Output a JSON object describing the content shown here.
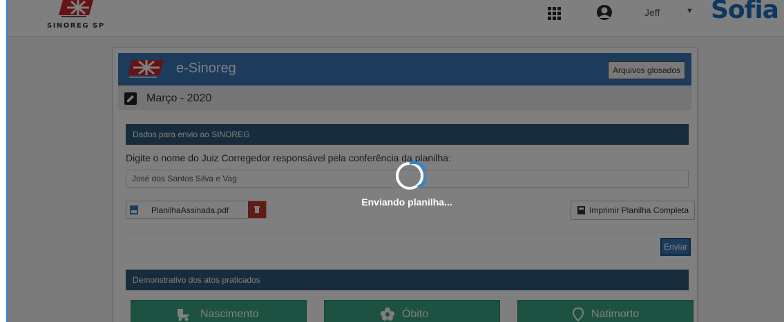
{
  "topbar": {
    "logo_text": "SINOREG SP",
    "user_name": "Jeff",
    "brand": "Sofia"
  },
  "card": {
    "header_title": "e-Sinoreg",
    "glosados_button": "Arquivos glosados",
    "period": "Março - 2020",
    "section_envio": "Dados para envio ao SINOREG",
    "prompt": "Digite o nome do Juiz Corregedor responsável pela conferência da planilha:",
    "judge_value": "José dos Santos Silva e Vag",
    "file_name": "PlanilhaAssinada.pdf",
    "print_button": "Imprimir Planilha Completa",
    "send_button": "Enviar",
    "section_atos": "Demonstrativo dos atos praticados",
    "acts": [
      "Nascimento",
      "Óbito",
      "Natimorto"
    ]
  },
  "overlay": {
    "loading_text": "Enviando planilha..."
  },
  "colors": {
    "header_blue": "#3b79b8",
    "section_navy": "#2f5878",
    "act_green": "#3aa382",
    "delete_red": "#c0392b",
    "brand_blue": "#1f6fbf"
  },
  "icons": [
    "apps-grid-icon",
    "user-avatar-icon",
    "caret-down-icon",
    "edit-icon",
    "file-icon",
    "trash-icon",
    "print-icon",
    "stroller-icon",
    "flower-icon",
    "location-pin-icon",
    "spinner-icon"
  ]
}
